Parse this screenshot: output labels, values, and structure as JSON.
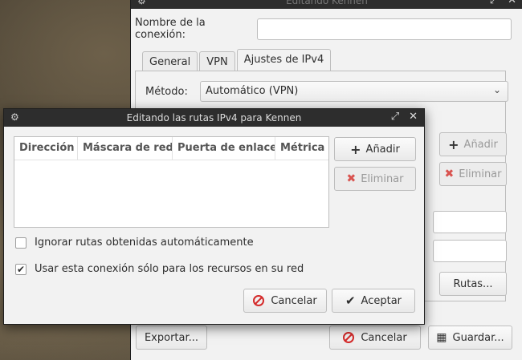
{
  "main_window": {
    "title": "Editando Kennen",
    "connection_label": "Nombre de la conexión:",
    "connection_value": "",
    "tabs": [
      {
        "label": "General"
      },
      {
        "label": "VPN"
      },
      {
        "label": "Ajustes de IPv4"
      }
    ],
    "method_label": "Método:",
    "method_value": "Automático (VPN)",
    "add_label": "Añadir",
    "remove_label": "Eliminar",
    "routes_label": "Rutas...",
    "export_label": "Exportar...",
    "cancel_label": "Cancelar",
    "save_label": "Guardar..."
  },
  "dialog": {
    "title": "Editando las rutas IPv4 para Kennen",
    "columns": [
      "Dirección",
      "Máscara de red",
      "Puerta de enlace",
      "Métrica"
    ],
    "add_label": "Añadir",
    "remove_label": "Eliminar",
    "ignore_routes_label": "Ignorar rutas obtenidas automáticamente",
    "ignore_routes_checked": false,
    "only_resources_label": "Usar esta conexión sólo para los recursos en su red",
    "only_resources_checked": true,
    "cancel_label": "Cancelar",
    "accept_label": "Aceptar"
  },
  "icons": {
    "window_menu": "gear-icon",
    "maximize": "maximize-icon",
    "close": "close-icon"
  },
  "colors": {
    "titlebar": "#2d2d2d",
    "cancel_icon": "#d42a2a",
    "remove_icon": "#d9534f"
  }
}
